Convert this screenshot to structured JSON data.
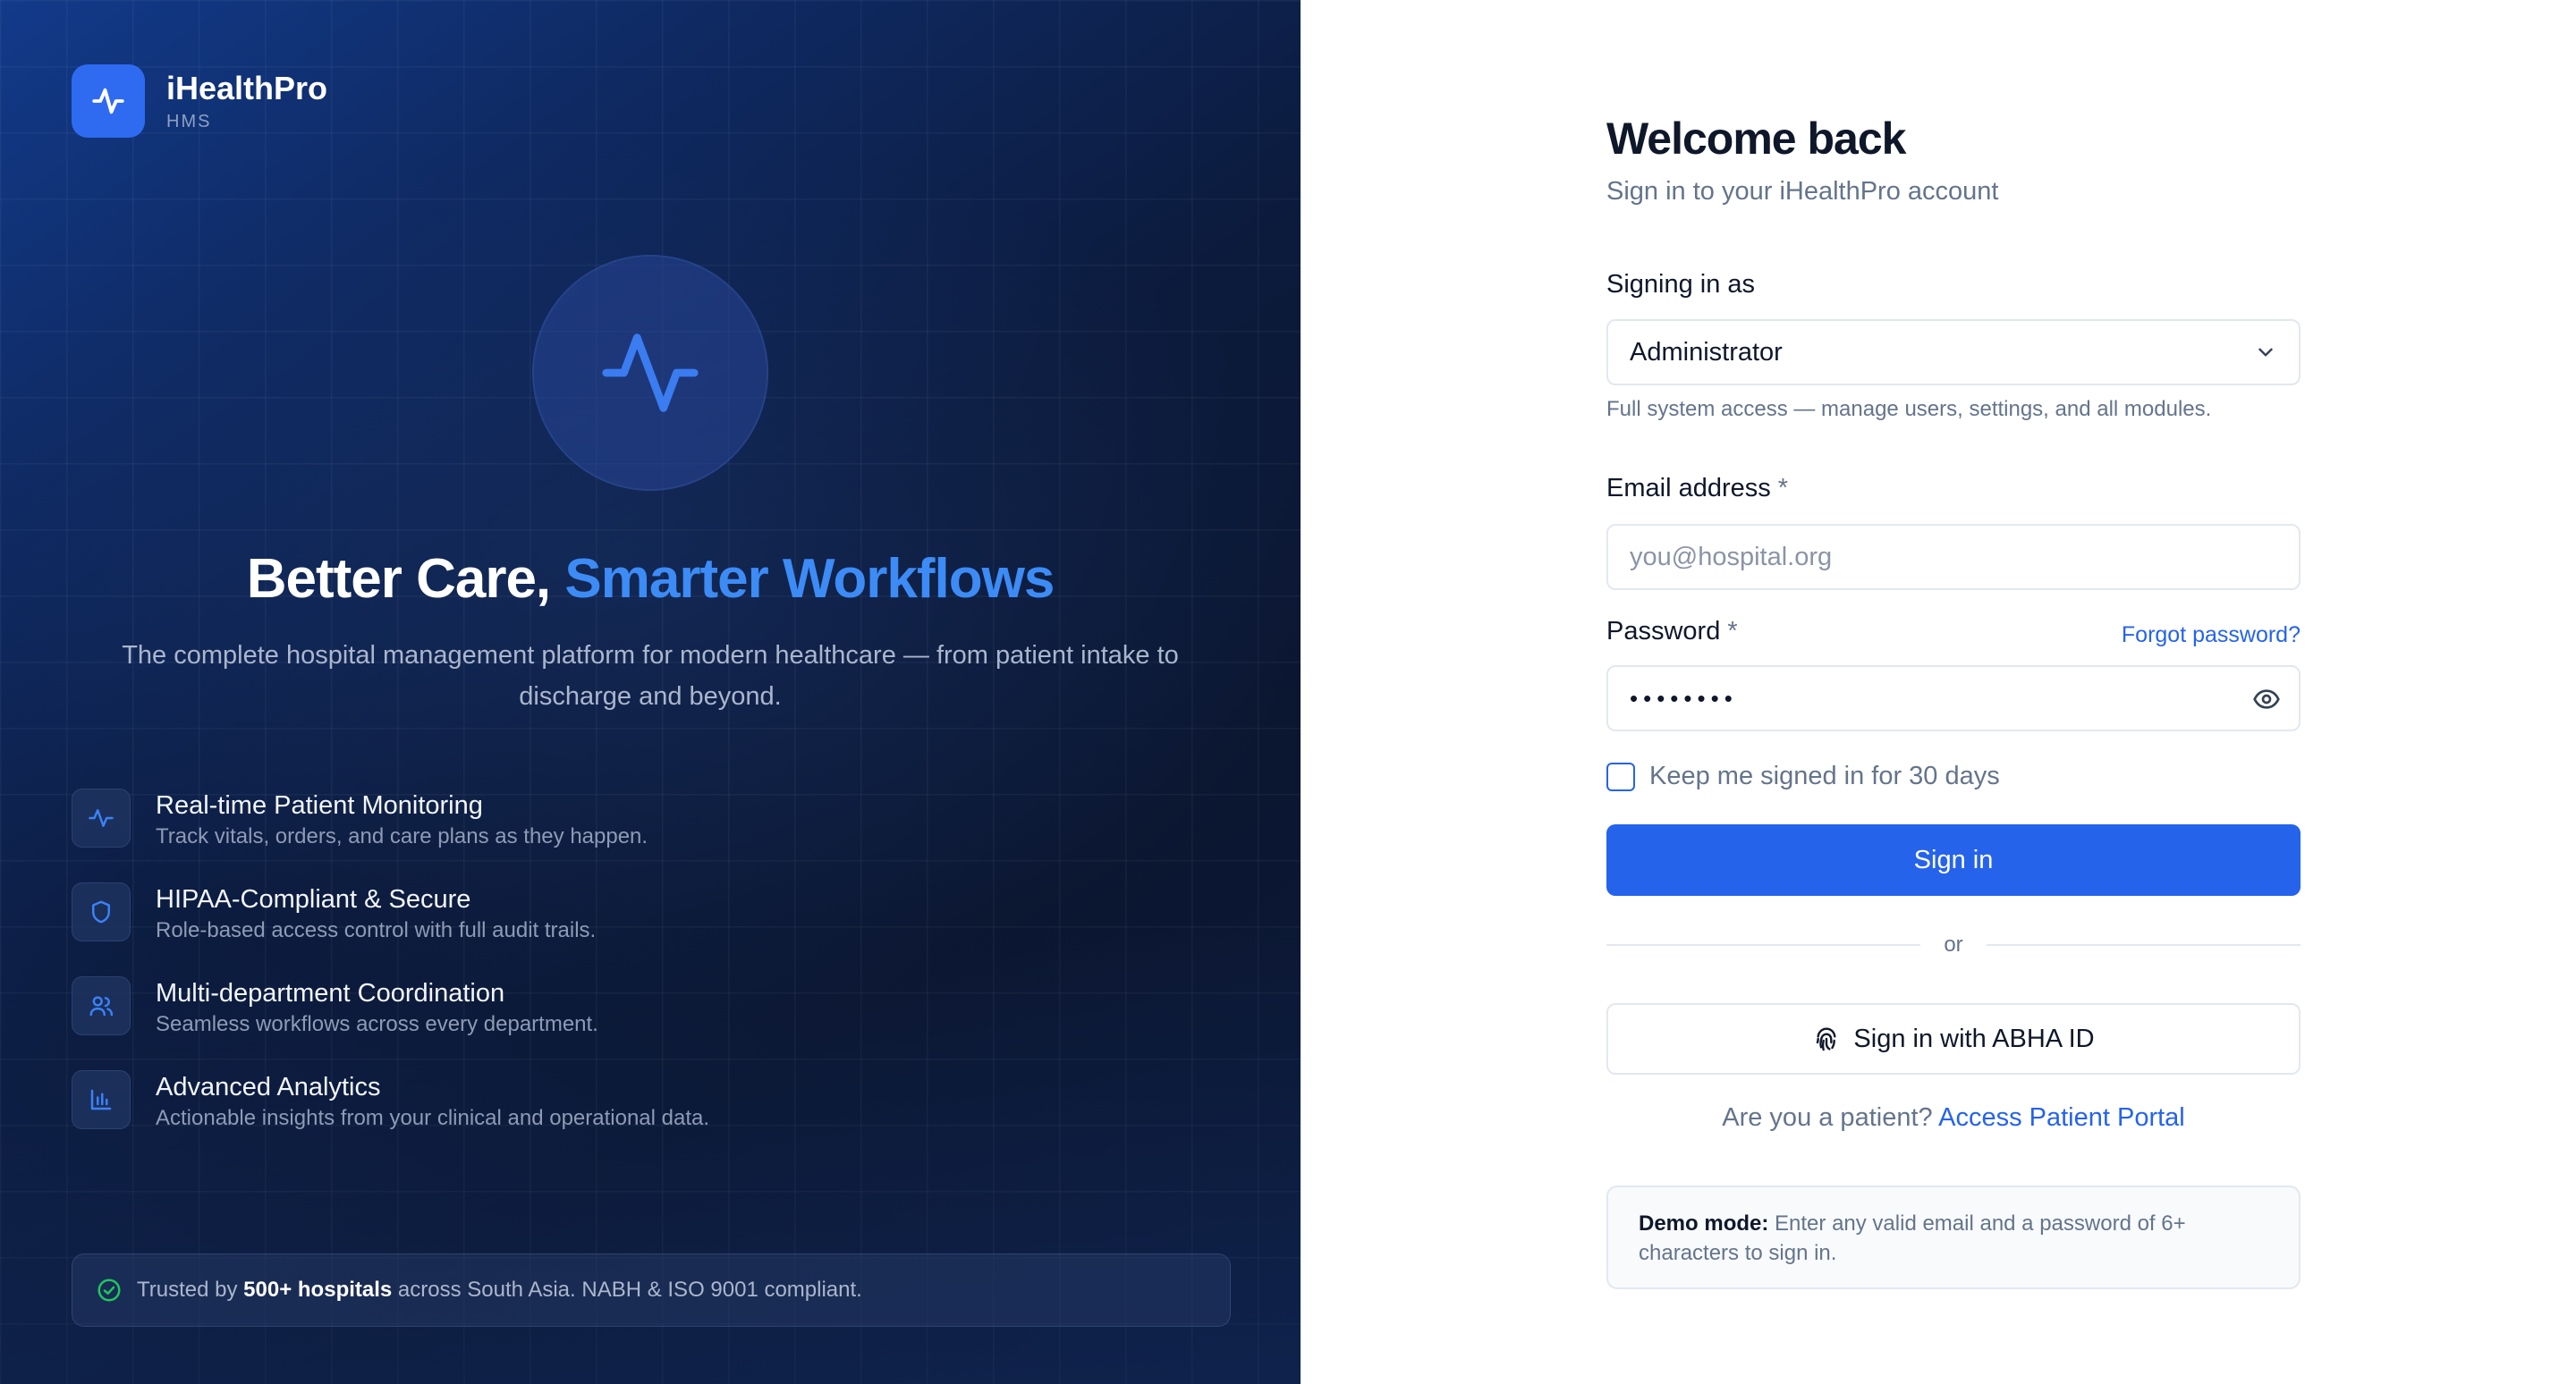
{
  "brand": {
    "name": "iHealthPro",
    "sub": "HMS"
  },
  "hero": {
    "headline_part1": "Better Care,",
    "headline_part2": "Smarter Workflows",
    "subline": "The complete hospital management platform for modern healthcare — from patient intake to discharge and beyond.",
    "features": [
      {
        "icon": "activity-icon",
        "title": "Real-time Patient Monitoring",
        "desc": "Track vitals, orders, and care plans as they happen."
      },
      {
        "icon": "shield-icon",
        "title": "HIPAA-Compliant & Secure",
        "desc": "Role-based access control with full audit trails."
      },
      {
        "icon": "users-icon",
        "title": "Multi-department Coordination",
        "desc": "Seamless workflows across every department."
      },
      {
        "icon": "bar-chart-icon",
        "title": "Advanced Analytics",
        "desc": "Actionable insights from your clinical and operational data."
      }
    ],
    "trust": {
      "prefix": "Trusted by",
      "highlight": "500+ hospitals",
      "suffix": "across South Asia. NABH & ISO 9001 compliant."
    }
  },
  "form": {
    "title": "Welcome back",
    "subtitle": "Sign in to your iHealthPro account",
    "role_label": "Signing in as",
    "role_value": "Administrator",
    "role_help": "Full system access — manage users, settings, and all modules.",
    "email_label": "Email address",
    "email_placeholder": "you@hospital.org",
    "password_label": "Password",
    "password_value": "••••••••",
    "required_mark": "*",
    "forgot": "Forgot password?",
    "remember": "Keep me signed in for 30 days",
    "submit": "Sign in",
    "or": "or",
    "abha": "Sign in with ABHA ID",
    "patient_prompt": "Are you a patient?",
    "patient_link": "Access Patient Portal",
    "demo_label": "Demo mode:",
    "demo_text": "Enter any valid email and a password of 6+ characters to sign in."
  },
  "colors": {
    "accent": "#2563eb",
    "hero_accent": "#3d8bf5",
    "success": "#22c55e"
  }
}
